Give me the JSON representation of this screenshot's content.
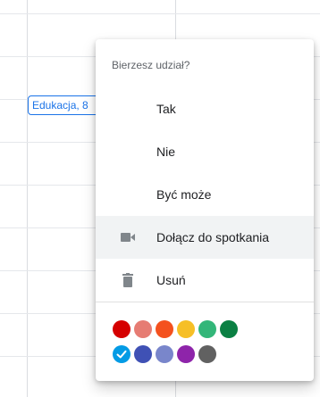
{
  "event": {
    "label": "Edukacja, 8"
  },
  "menu": {
    "header": "Bierzesz udział?",
    "rsvp": [
      {
        "label": "Tak"
      },
      {
        "label": "Nie"
      },
      {
        "label": "Być może"
      }
    ],
    "join_label": "Dołącz do spotkania",
    "delete_label": "Usuń"
  },
  "colors": {
    "row1": [
      "#d50000",
      "#e67c73",
      "#f4511e",
      "#f6bf26",
      "#33b679",
      "#0b8043"
    ],
    "row2": [
      "#039be5",
      "#3f51b5",
      "#7986cb",
      "#8e24aa",
      "#616161"
    ],
    "selected": "#039be5"
  },
  "icons": {
    "join": "video-camera-icon",
    "delete": "trash-icon",
    "selected": "check-icon"
  }
}
